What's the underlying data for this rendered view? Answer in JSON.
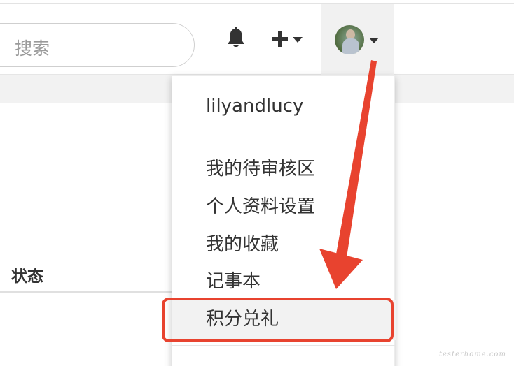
{
  "header": {
    "search_placeholder": "搜索",
    "icons": [
      "bell-icon",
      "plus-icon",
      "chevron-down-icon",
      "avatar"
    ]
  },
  "table": {
    "status_header": "状态"
  },
  "user_menu": {
    "username": "lilyandlucy",
    "items": [
      "我的待审核区",
      "个人资料设置",
      "我的收藏",
      "记事本",
      "积分兑礼"
    ],
    "highlighted_item": "积分兑礼"
  },
  "annotation": {
    "color": "#e8432f"
  },
  "watermark": "testerhome.com"
}
